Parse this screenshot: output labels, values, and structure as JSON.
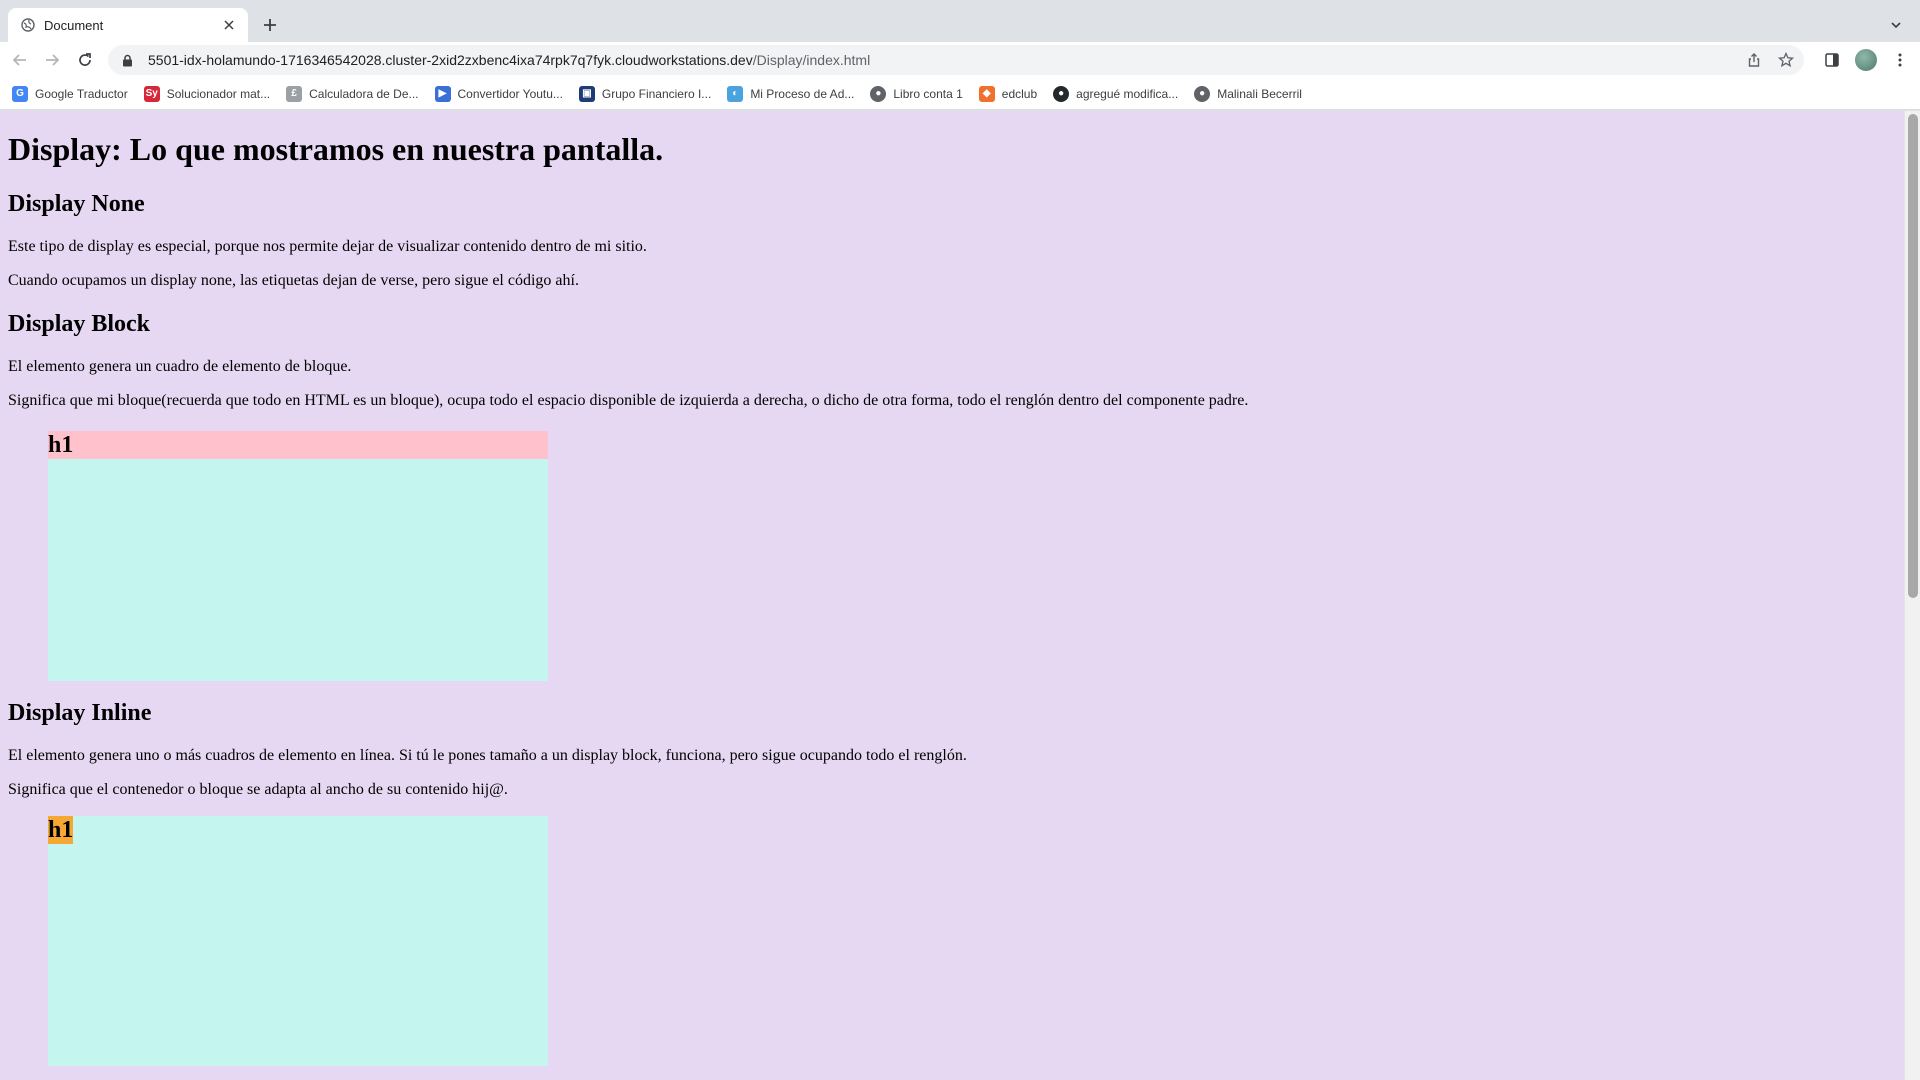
{
  "browser": {
    "tab": {
      "title": "Document"
    },
    "url": {
      "host": "5501-idx-holamundo-1716346542028.cluster-2xid2zxbenc4ixa74rpk7q7fyk.cloudworkstations.dev",
      "path": "/Display/index.html"
    },
    "bookmarks": [
      {
        "label": "Google Traductor",
        "icon": "google-translate-icon",
        "color": "#4285f4"
      },
      {
        "label": "Solucionador mat...",
        "icon": "symbolab-icon",
        "color": "#d6283b"
      },
      {
        "label": "Calculadora de De...",
        "icon": "calculator-icon",
        "color": "#9aa0a6"
      },
      {
        "label": "Convertidor Youtu...",
        "icon": "youtube-converter-icon",
        "color": "#3b6fd8"
      },
      {
        "label": "Grupo Financiero I...",
        "icon": "bank-icon",
        "color": "#1f3c74"
      },
      {
        "label": "Mi Proceso de Ad...",
        "icon": "flame-icon",
        "color": "#4aa3df"
      },
      {
        "label": "Libro conta 1",
        "icon": "globe-icon",
        "color": "#5f6368"
      },
      {
        "label": "edclub",
        "icon": "edclub-icon",
        "color": "#f0712c"
      },
      {
        "label": "agregué modifica...",
        "icon": "github-icon",
        "color": "#24292e"
      },
      {
        "label": "Malinali Becerril",
        "icon": "globe-icon",
        "color": "#5f6368"
      }
    ]
  },
  "page": {
    "title": "Display: Lo que mostramos en nuestra pantalla.",
    "none": {
      "heading": "Display None",
      "p1": "Este tipo de display es especial, porque nos permite dejar de visualizar contenido dentro de mi sitio.",
      "p2": "Cuando ocupamos un display none, las etiquetas dejan de verse, pero sigue el código ahí."
    },
    "block": {
      "heading": "Display Block",
      "p1": "El elemento genera un cuadro de elemento de bloque.",
      "p2": "Significa que mi bloque(recuerda que todo en HTML es un bloque), ocupa todo el espacio disponible de izquierda a derecha, o dicho de otra forma, todo el renglón dentro del componente padre.",
      "demo_heading": "h1"
    },
    "inline": {
      "heading": "Display Inline",
      "p1": "El elemento genera uno o más cuadros de elemento en línea. Si tú le pones tamaño a un display block, funciona, pero sigue ocupando todo el renglón.",
      "p2": "Significa que el contenedor o bloque se adapta al ancho de su contenido hij@.",
      "demo_heading": "h1"
    },
    "colors": {
      "background": "#e6d8f2",
      "demo_box": "#c4f5ef",
      "block_heading": "#ffc2cc",
      "inline_heading": "#f5a833"
    }
  }
}
